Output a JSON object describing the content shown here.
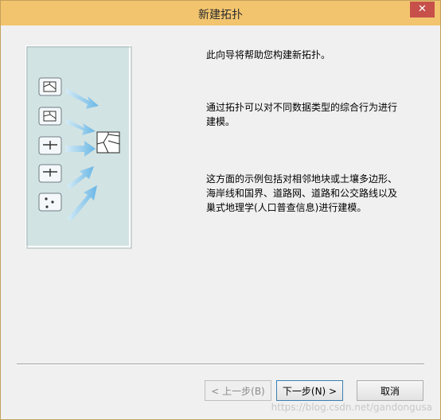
{
  "window": {
    "title": "新建拓扑",
    "close_glyph": "✕"
  },
  "intro": {
    "paragraph1": "此向导将帮助您构建新拓扑。",
    "paragraph2": "通过拓扑可以对不同数据类型的综合行为进行建模。",
    "paragraph3": "这方面的示例包括对相邻地块或土壤多边形、海岸线和国界、道路网、道路和公交路线以及巢式地理学(人口普查信息)进行建模。"
  },
  "buttons": {
    "back": "< 上一步(B)",
    "next": "下一步(N) >",
    "cancel": "取消"
  },
  "illustration": {
    "input_icons": [
      "polygon-icon",
      "polygon-icon",
      "line-icon",
      "line-icon",
      "point-icon"
    ],
    "result_icon": "topology-icon"
  },
  "watermark": "https://blog.csdn.net/gandongusa",
  "colors": {
    "titlebar": "#f2c46e",
    "close": "#c7504b",
    "panel_bg": "#d2e3e3",
    "arrow": "#88c4e6"
  }
}
